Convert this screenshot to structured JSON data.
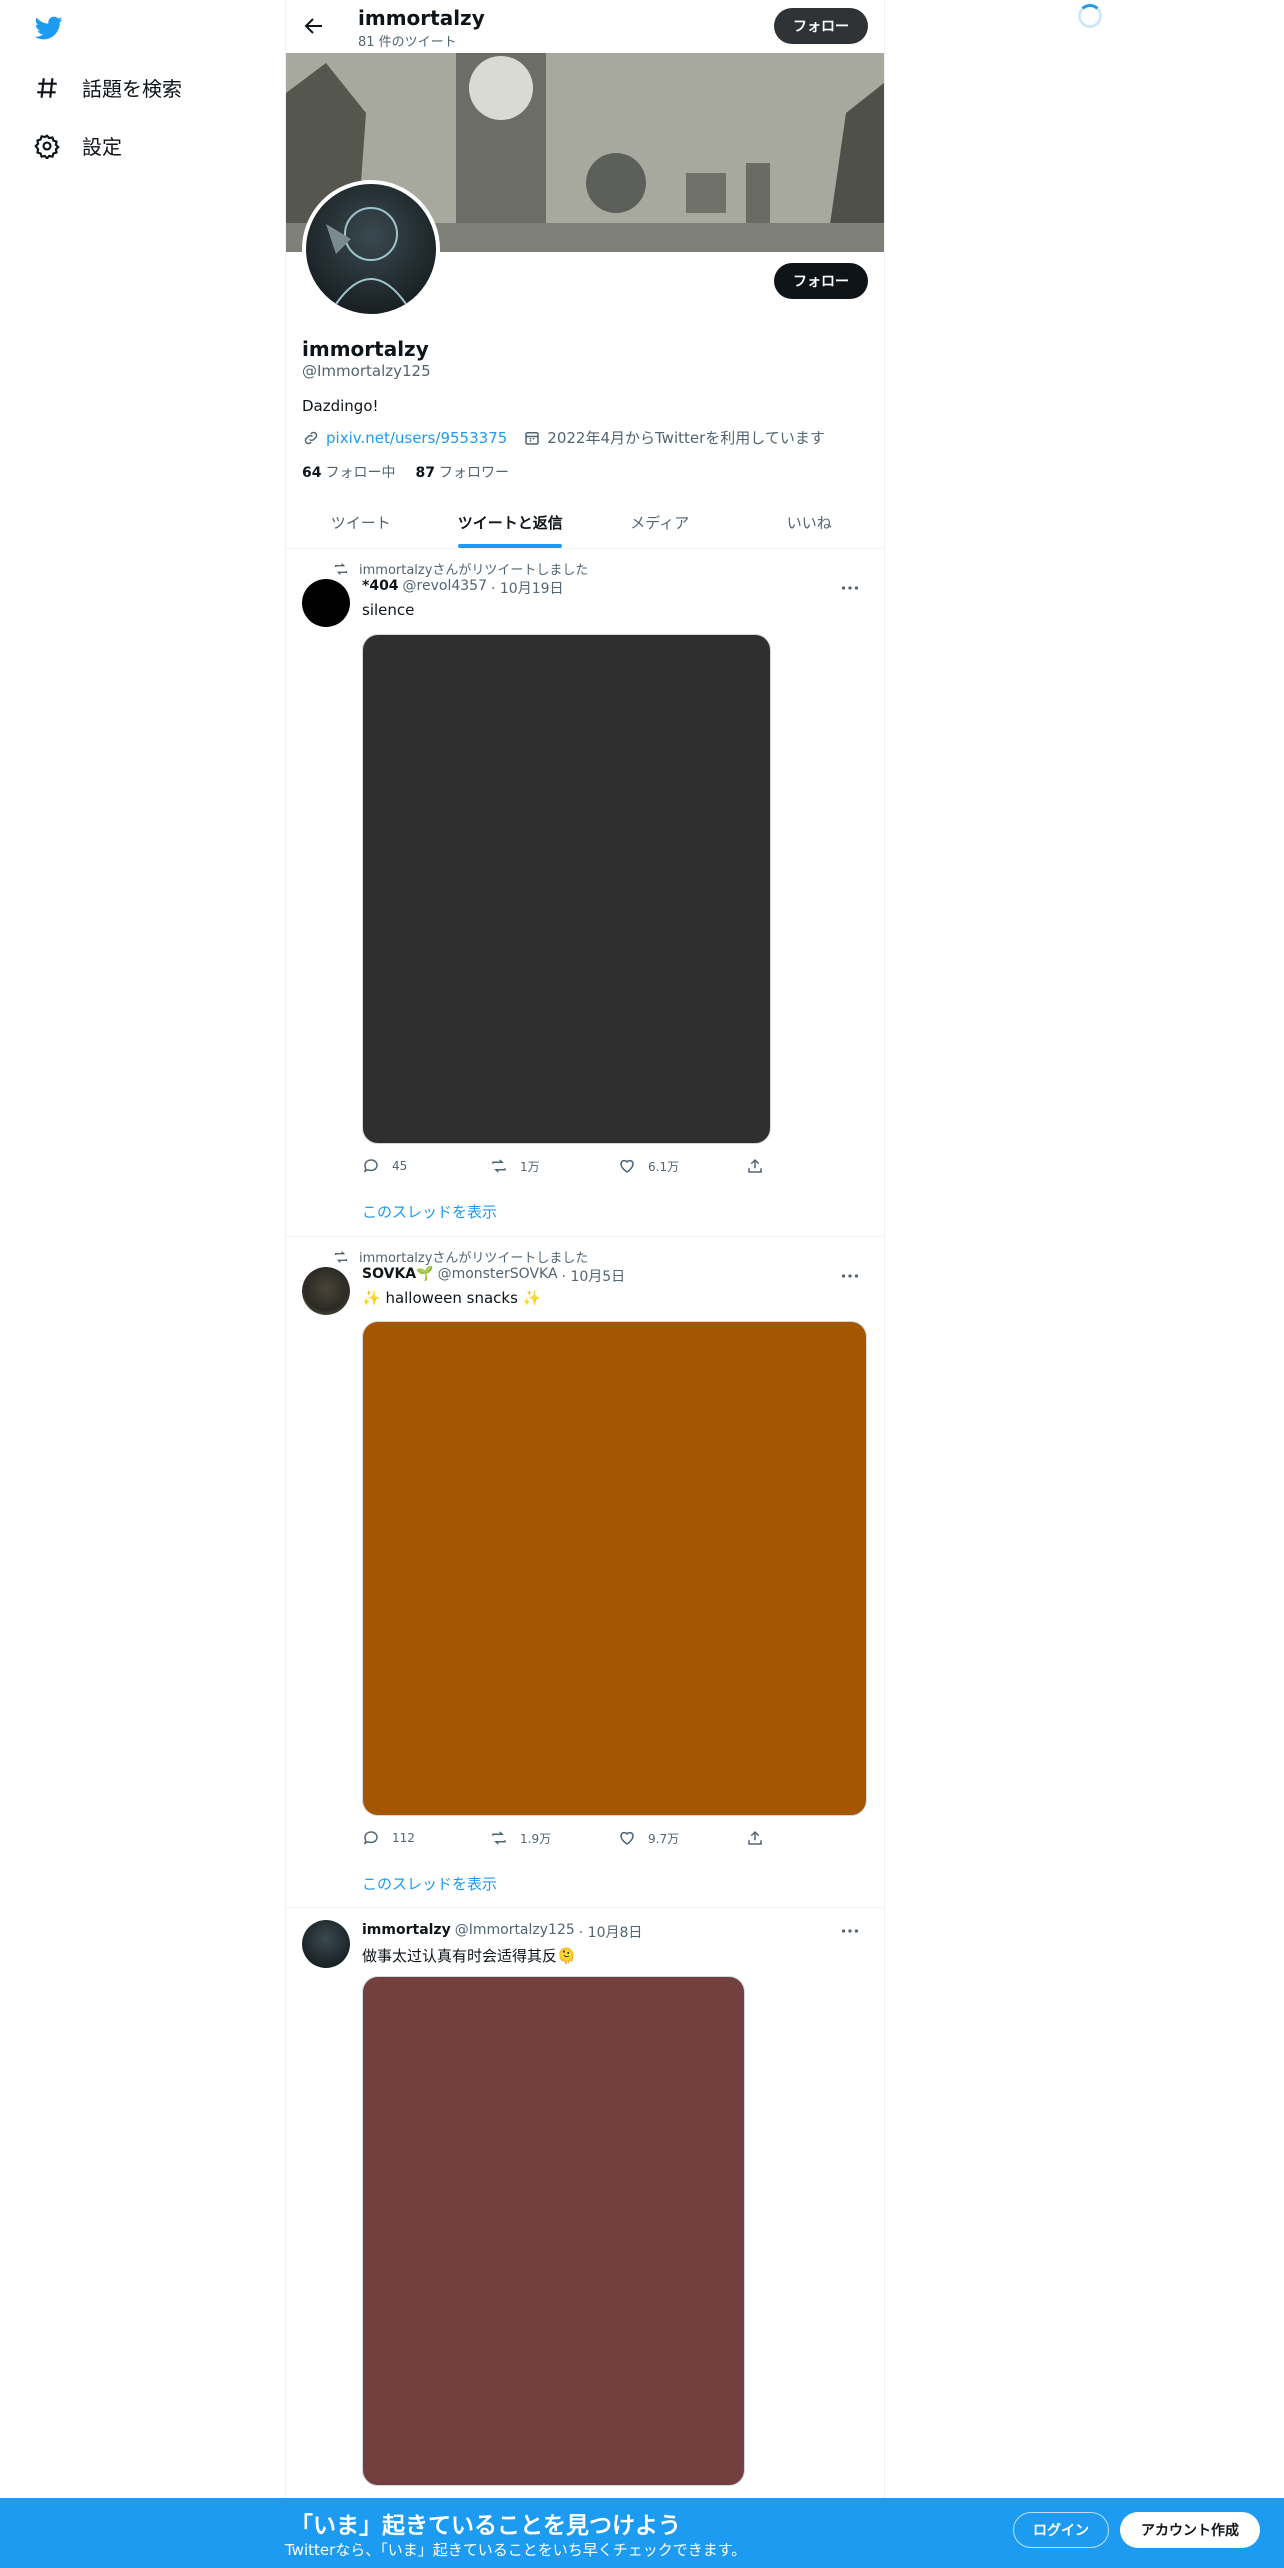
{
  "nav": {
    "explore_label": "話題を検索",
    "settings_label": "設定"
  },
  "profile": {
    "name": "immortalzy",
    "tweet_count": "81 件のツイート",
    "follow_label": "フォロー",
    "handle": "@Immortalzy125",
    "bio": "Dazdingo!",
    "website": "pixiv.net/users/9553375",
    "joined": "2022年4月からTwitterを利用しています",
    "following_count": "64",
    "following_label": "フォロー中",
    "followers_count": "87",
    "followers_label": "フォロワー"
  },
  "tabs": [
    "ツイート",
    "ツイートと返信",
    "メディア",
    "いいね"
  ],
  "tweets": [
    {
      "retweet_note": "immortalzyさんがリツイートしました",
      "author": "*404",
      "handle": "@revol4357",
      "date": "· 10月19日",
      "text": "silence",
      "media_color": "#2f2f2f",
      "replies": "45",
      "retweets": "1万",
      "likes": "6.1万",
      "thread_label": "このスレッドを表示"
    },
    {
      "retweet_note": "immortalzyさんがリツイートしました",
      "author": "SOVKA🌱",
      "handle": "@monsterSOVKA",
      "date": "· 10月5日",
      "text": "✨ halloween snacks ✨",
      "media_color": "#a55600",
      "replies": "112",
      "retweets": "1.9万",
      "likes": "9.7万",
      "thread_label": "このスレッドを表示"
    },
    {
      "author": "immortalzy",
      "handle": "@Immortalzy125",
      "date": "· 10月8日",
      "text": "做事太过认真有时会适得其反🫠",
      "media_color": "#733f3f"
    }
  ],
  "bottom_bar": {
    "title": "「いま」起きていることを見つけよう",
    "subtitle": "Twitterなら、「いま」起きていることをいち早くチェックできます。",
    "login_label": "ログイン",
    "signup_label": "アカウント作成"
  },
  "colors": {
    "accent": "#1d9bf0",
    "text": "#0f1419",
    "muted": "#536471"
  }
}
